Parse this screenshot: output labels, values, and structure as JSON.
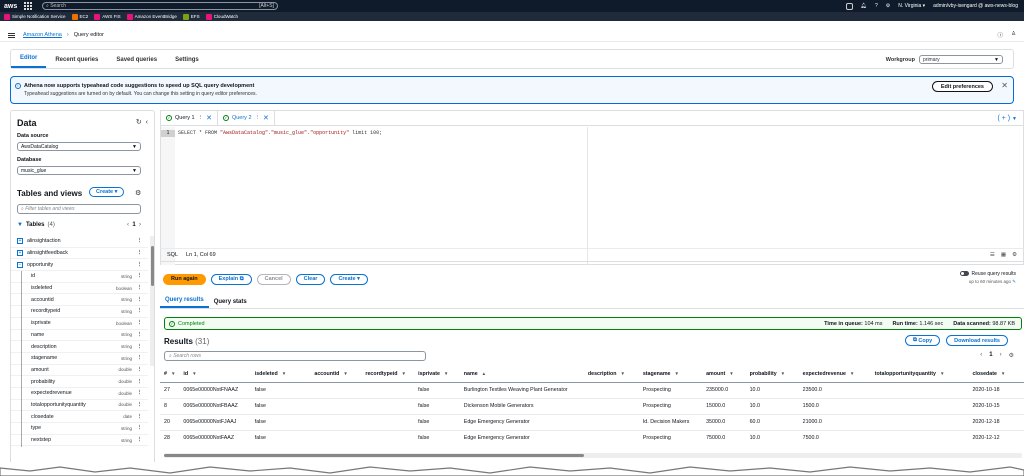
{
  "topnav": {
    "logo": "aws",
    "search_placeholder": "Search",
    "search_shortcut": "[Alt+S]",
    "region": "N. Virginia ▾",
    "account": "admin/vby-isengard @ aws-news-blog"
  },
  "favorites": [
    {
      "label": "Simple Notification Service",
      "color": "#e7157b"
    },
    {
      "label": "EC2",
      "color": "#ed7100"
    },
    {
      "label": "AWS FIS",
      "color": "#e7157b"
    },
    {
      "label": "Amazon EventBridge",
      "color": "#e7157b"
    },
    {
      "label": "EFS",
      "color": "#7aa116"
    },
    {
      "label": "CloudWatch",
      "color": "#e7157b"
    }
  ],
  "breadcrumb": {
    "root": "Amazon Athena",
    "current": "Query editor"
  },
  "tabs": [
    "Editor",
    "Recent queries",
    "Saved queries",
    "Settings"
  ],
  "workgroup": {
    "label": "Workgroup",
    "value": "primary"
  },
  "flash": {
    "title": "Athena now supports typeahead code suggestions to speed up SQL query development",
    "body": "Typeahead suggestions are turned on by default. You can change this setting in query editor preferences.",
    "button": "Edit preferences"
  },
  "data_panel": {
    "title": "Data",
    "datasource_label": "Data source",
    "datasource": "AwsDataCatalog",
    "database_label": "Database",
    "database": "music_glue",
    "tv_title": "Tables and views",
    "create": "Create ▾",
    "filter_placeholder": "Filter tables and views",
    "tables_label": "Tables",
    "tables_count": "(4)",
    "page": "1"
  },
  "tables": [
    {
      "name": "alinsightaction",
      "kind": "table"
    },
    {
      "name": "alinsightfeedback",
      "kind": "table"
    },
    {
      "name": "opportunity",
      "kind": "table-open"
    },
    {
      "name": "id",
      "type": "string",
      "kind": "col"
    },
    {
      "name": "isdeleted",
      "type": "boolean",
      "kind": "col"
    },
    {
      "name": "accountid",
      "type": "string",
      "kind": "col"
    },
    {
      "name": "recordtypeid",
      "type": "string",
      "kind": "col"
    },
    {
      "name": "isprivate",
      "type": "boolean",
      "kind": "col"
    },
    {
      "name": "name",
      "type": "string",
      "kind": "col"
    },
    {
      "name": "description",
      "type": "string",
      "kind": "col"
    },
    {
      "name": "stagename",
      "type": "string",
      "kind": "col"
    },
    {
      "name": "amount",
      "type": "double",
      "kind": "col"
    },
    {
      "name": "probability",
      "type": "double",
      "kind": "col"
    },
    {
      "name": "expectedrevenue",
      "type": "double",
      "kind": "col"
    },
    {
      "name": "totalopportunityquantity",
      "type": "double",
      "kind": "col"
    },
    {
      "name": "closedate",
      "type": "date",
      "kind": "col"
    },
    {
      "name": "type",
      "type": "string",
      "kind": "col"
    },
    {
      "name": "nextstep",
      "type": "string",
      "kind": "col"
    }
  ],
  "query_tabs": [
    "Query 1",
    "Query 2"
  ],
  "sql": {
    "line": "1",
    "pre": "SELECT * FROM ",
    "s1": "\"AwsDataCatalog\"",
    "d1": ".",
    "s2": "\"music_glue\"",
    "d2": ".",
    "s3": "\"opportunity\"",
    "post": " limit 100;"
  },
  "status": {
    "lang": "SQL",
    "pos": "Ln 1, Col 69"
  },
  "actions": {
    "run": "Run again",
    "explain": "Explain",
    "cancel": "Cancel",
    "clear": "Clear",
    "create": "Create ▾"
  },
  "reuse": {
    "label": "Reuse query results",
    "sub": "up to 60 minutes ago"
  },
  "result_tabs": [
    "Query results",
    "Query stats"
  ],
  "completed": {
    "label": "Completed",
    "q_label": "Time in queue:",
    "q": "104 ms",
    "r_label": "Run time:",
    "r": "1.146 sec",
    "s_label": "Data scanned:",
    "s": "98.87 KB"
  },
  "results": {
    "title": "Results",
    "count": "(31)",
    "copy": "Copy",
    "download": "Download results",
    "search_placeholder": "Search rows",
    "page": "1"
  },
  "columns": [
    "#",
    "id",
    "isdeleted",
    "accountid",
    "recordtypeid",
    "isprivate",
    "name",
    "description",
    "stagename",
    "amount",
    "probability",
    "expectedrevenue",
    "totalopportunityquantity",
    "closedate"
  ],
  "rows": [
    [
      "27",
      "0065e00000NxtFNAAZ",
      "false",
      "",
      "",
      "false",
      "Burlington Textiles Weaving Plant Generator",
      "",
      "Prospecting",
      "235000.0",
      "10.0",
      "23500.0",
      "",
      "2020-10-18"
    ],
    [
      "8",
      "0065e00000NxtFBAAZ",
      "false",
      "",
      "",
      "false",
      "Dickenson Mobile Generators",
      "",
      "Prospecting",
      "15000.0",
      "10.0",
      "1500.0",
      "",
      "2020-10-15"
    ],
    [
      "20",
      "0065e00000NxtFJAAJ",
      "false",
      "",
      "",
      "false",
      "Edge Emergency Generator",
      "",
      "Id. Decision Makers",
      "35000.0",
      "60.0",
      "21000.0",
      "",
      "2020-12-18"
    ],
    [
      "28",
      "0065e00000NxtFAAZ",
      "false",
      "",
      "",
      "false",
      "Edge Emergency Generator",
      "",
      "Prospecting",
      "75000.0",
      "10.0",
      "7500.0",
      "",
      "2020-12-12"
    ]
  ]
}
